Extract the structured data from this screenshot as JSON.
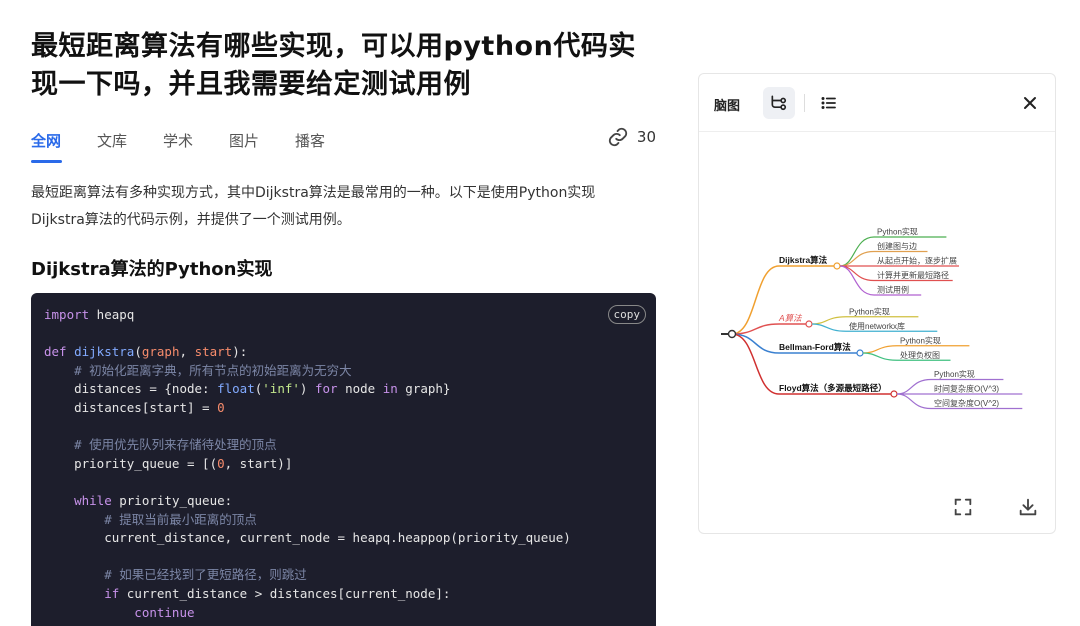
{
  "title": "最短距离算法有哪些实现，可以用python代码实现一下吗，并且我需要给定测试用例",
  "tabs": [
    "全网",
    "文库",
    "学术",
    "图片",
    "播客"
  ],
  "link_count": "30",
  "intro": "最短距离算法有多种实现方式，其中Dijkstra算法是最常用的一种。以下是使用Python实现Dijkstra算法的代码示例，并提供了一个测试用例。",
  "section_heading": "Dijkstra算法的Python实现",
  "code": {
    "copy_label": "copy",
    "lines": [
      [
        [
          "kw",
          "import"
        ],
        [
          "t",
          " heapq"
        ]
      ],
      [],
      [
        [
          "kw",
          "def"
        ],
        [
          "t",
          " "
        ],
        [
          "fn",
          "dijkstra"
        ],
        [
          "t",
          "("
        ],
        [
          "pm",
          "graph"
        ],
        [
          "t",
          ", "
        ],
        [
          "pm",
          "start"
        ],
        [
          "t",
          "):"
        ]
      ],
      [
        [
          "cm",
          "    # 初始化距离字典，所有节点的初始距离为无穷大"
        ]
      ],
      [
        [
          "t",
          "    distances = {node: "
        ],
        [
          "fn",
          "float"
        ],
        [
          "t",
          "("
        ],
        [
          "str",
          "'inf'"
        ],
        [
          "t",
          ") "
        ],
        [
          "kw",
          "for"
        ],
        [
          "t",
          " node "
        ],
        [
          "kw",
          "in"
        ],
        [
          "t",
          " graph}"
        ]
      ],
      [
        [
          "t",
          "    distances[start] = "
        ],
        [
          "num",
          "0"
        ]
      ],
      [],
      [
        [
          "cm",
          "    # 使用优先队列来存储待处理的顶点"
        ]
      ],
      [
        [
          "t",
          "    priority_queue = [("
        ],
        [
          "num",
          "0"
        ],
        [
          "t",
          ", start)]"
        ]
      ],
      [],
      [
        [
          "kw",
          "    while"
        ],
        [
          "t",
          " priority_queue:"
        ]
      ],
      [
        [
          "cm",
          "        # 提取当前最小距离的顶点"
        ]
      ],
      [
        [
          "t",
          "        current_distance, current_node = heapq.heappop(priority_queue)"
        ]
      ],
      [],
      [
        [
          "cm",
          "        # 如果已经找到了更短路径，则跳过"
        ]
      ],
      [
        [
          "kw",
          "        if"
        ],
        [
          "t",
          " current_distance > distances[current_node]:"
        ]
      ],
      [
        [
          "kw",
          "            continue"
        ]
      ]
    ]
  },
  "panel": {
    "title": "脑图",
    "mindmap": {
      "branches": [
        {
          "label": "Dijkstra算法",
          "color": "#f0a030",
          "children": [
            "Python实现",
            "创建图与边",
            "从起点开始，逐步扩展",
            "计算并更新最短路径",
            "测试用例"
          ],
          "child_colors": [
            "#4caf50",
            "#e0a050",
            "#e05050",
            "#e05050",
            "#b060d0"
          ]
        },
        {
          "label": "A算法",
          "color": "#e05050",
          "children": [
            "Python实现",
            "使用networkx库"
          ],
          "child_colors": [
            "#d0c040",
            "#40b0d0"
          ]
        },
        {
          "label": "Bellman-Ford算法",
          "color": "#3a80d0",
          "children": [
            "Python实现",
            "处理负权图"
          ],
          "child_colors": [
            "#f0a030",
            "#40c080"
          ]
        },
        {
          "label": "Floyd算法（多源最短路径）",
          "color": "#d03030",
          "children": [
            "Python实现",
            "时间复杂度O(V^3)",
            "空间复杂度O(V^2)"
          ],
          "child_colors": [
            "#a070d0",
            "#a070d0",
            "#a070d0"
          ]
        }
      ]
    }
  }
}
